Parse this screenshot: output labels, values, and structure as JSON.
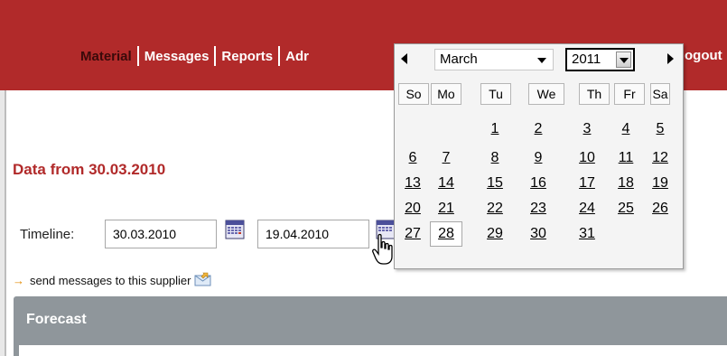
{
  "nav": {
    "items": [
      {
        "label": "Material",
        "active": true
      },
      {
        "label": "Messages",
        "active": false
      },
      {
        "label": "Reports",
        "active": false
      },
      {
        "label": "Adr",
        "active": false
      }
    ],
    "logout_label": "ogout"
  },
  "page": {
    "title": "Data from 30.03.2010"
  },
  "timeline": {
    "label": "Timeline:",
    "start_date": "30.03.2010",
    "end_date": "19.04.2010"
  },
  "send_link": {
    "arrow": "→",
    "label": "send messages to this supplier"
  },
  "forecast": {
    "title": "Forecast"
  },
  "calendar": {
    "month": "March",
    "year": "2011",
    "weekdays": [
      "So",
      "Mo",
      "Tu",
      "We",
      "Th",
      "Fr",
      "Sa"
    ],
    "today": "28",
    "weeks": [
      [
        "",
        "",
        "1",
        "2",
        "3",
        "4",
        "5"
      ],
      [
        "6",
        "7",
        "8",
        "9",
        "10",
        "11",
        "12"
      ],
      [
        "13",
        "14",
        "15",
        "16",
        "17",
        "18",
        "19"
      ],
      [
        "20",
        "21",
        "22",
        "23",
        "24",
        "25",
        "26"
      ],
      [
        "27",
        "28",
        "29",
        "30",
        "31",
        "",
        ""
      ]
    ]
  },
  "colors": {
    "header": "#b12a2a",
    "title": "#b12a2a",
    "forecast_bar": "#8f969b",
    "link_arrow": "#e38a00"
  }
}
